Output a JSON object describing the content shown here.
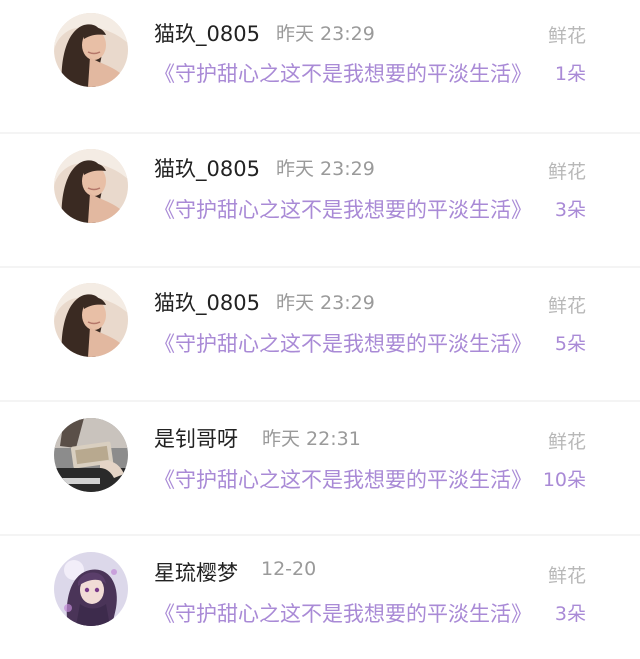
{
  "gifts": [
    {
      "user": "猫玖_0805",
      "time": "昨天 23:29",
      "gift_type": "鲜花",
      "book": "《守护甜心之这不是我想要的平淡生活》",
      "count": "1朵",
      "avatar_icon": "user-avatar-girl-photo"
    },
    {
      "user": "猫玖_0805",
      "time": "昨天 23:29",
      "gift_type": "鲜花",
      "book": "《守护甜心之这不是我想要的平淡生活》",
      "count": "3朵",
      "avatar_icon": "user-avatar-girl-photo"
    },
    {
      "user": "猫玖_0805",
      "time": "昨天 23:29",
      "gift_type": "鲜花",
      "book": "《守护甜心之这不是我想要的平淡生活》",
      "count": "5朵",
      "avatar_icon": "user-avatar-girl-photo"
    },
    {
      "user": "是钊哥呀",
      "time": "昨天 22:31",
      "gift_type": "鲜花",
      "book": "《守护甜心之这不是我想要的平淡生活》",
      "count": "10朵",
      "avatar_icon": "user-avatar-money-photo"
    },
    {
      "user": "星琉樱梦",
      "time": "12-20",
      "gift_type": "鲜花",
      "book": "《守护甜心之这不是我想要的平淡生活》",
      "count": "3朵",
      "avatar_icon": "user-avatar-anime-girl"
    }
  ],
  "colors": {
    "accent": "#a98ad6",
    "name": "#222222",
    "meta": "#9a9a9a",
    "gift_label": "#b8b8b8"
  }
}
